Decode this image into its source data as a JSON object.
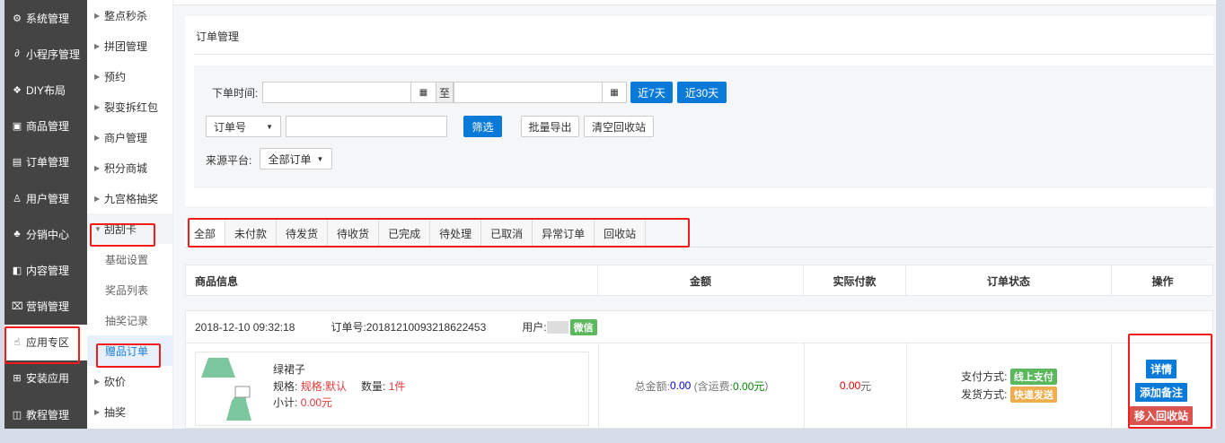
{
  "sidebar": {
    "items": [
      {
        "label": "系统管理",
        "icon": "gear-icon",
        "glyph": "⚙"
      },
      {
        "label": "小程序管理",
        "icon": "mini-program-icon",
        "glyph": "∂"
      },
      {
        "label": "DIY布局",
        "icon": "diy-icon",
        "glyph": "❖"
      },
      {
        "label": "商品管理",
        "icon": "bag-icon",
        "glyph": "▣"
      },
      {
        "label": "订单管理",
        "icon": "order-icon",
        "glyph": "▤"
      },
      {
        "label": "用户管理",
        "icon": "user-icon",
        "glyph": "♙"
      },
      {
        "label": "分销中心",
        "icon": "distribution-icon",
        "glyph": "♣"
      },
      {
        "label": "内容管理",
        "icon": "content-icon",
        "glyph": "◧"
      },
      {
        "label": "营销管理",
        "icon": "ticket-icon",
        "glyph": "⌧"
      },
      {
        "label": "应用专区",
        "icon": "hand-icon",
        "glyph": "☝"
      },
      {
        "label": "安装应用",
        "icon": "apps-icon",
        "glyph": "⊞"
      },
      {
        "label": "教程管理",
        "icon": "book-icon",
        "glyph": "◫"
      }
    ]
  },
  "subnav": {
    "items": [
      {
        "label": "整点秒杀"
      },
      {
        "label": "拼团管理"
      },
      {
        "label": "预约"
      },
      {
        "label": "裂变拆红包"
      },
      {
        "label": "商户管理"
      },
      {
        "label": "积分商城"
      },
      {
        "label": "九宫格抽奖"
      },
      {
        "label": "刮刮卡"
      },
      {
        "label": "基础设置"
      },
      {
        "label": "奖品列表"
      },
      {
        "label": "抽奖记录"
      },
      {
        "label": "赠品订单"
      },
      {
        "label": "砍价"
      },
      {
        "label": "抽奖"
      }
    ]
  },
  "page": {
    "title": "订单管理"
  },
  "filter": {
    "order_time_label": "下单时间:",
    "to_label": "至",
    "last7": "近7天",
    "last30": "近30天",
    "search_type": "订单号",
    "search_value": "",
    "filter_btn": "筛选",
    "export_btn": "批量导出",
    "clear_btn": "清空回收站",
    "source_label": "来源平台:",
    "source_value": "全部订单"
  },
  "tabs": [
    "全部",
    "未付款",
    "待发货",
    "待收货",
    "已完成",
    "待处理",
    "已取消",
    "异常订单",
    "回收站"
  ],
  "table": {
    "headers": [
      "商品信息",
      "金额",
      "实际付款",
      "订单状态",
      "操作"
    ]
  },
  "order": {
    "time": "2018-12-10 09:32:18",
    "no_label": "订单号:",
    "no": "20181210093218622453",
    "user_label": "用户:",
    "platform": "微信",
    "product": {
      "name": "绿裙子",
      "spec_label": "规格:",
      "spec": "规格:默认",
      "qty_label": "数量:",
      "qty": "1件",
      "subtotal_label": "小计:",
      "subtotal": "0.00元"
    },
    "total_label": "总金额:",
    "total": "0.00",
    "shipping_open": "(含运费:",
    "shipping": "0.00元",
    "shipping_close": ")",
    "paid": "0.00",
    "paid_unit": "元",
    "pay_label": "支付方式:",
    "pay": "线上支付",
    "ship_label": "发货方式:",
    "ship": "快递发送",
    "actions": {
      "detail": "详情",
      "note": "添加备注",
      "recycle": "移入回收站"
    }
  },
  "colors": {
    "primary": "#0a7ad8",
    "success": "#5cb85c",
    "warning": "#f0ad4e",
    "danger": "#d9534f",
    "highlight": "#f01c1c"
  }
}
